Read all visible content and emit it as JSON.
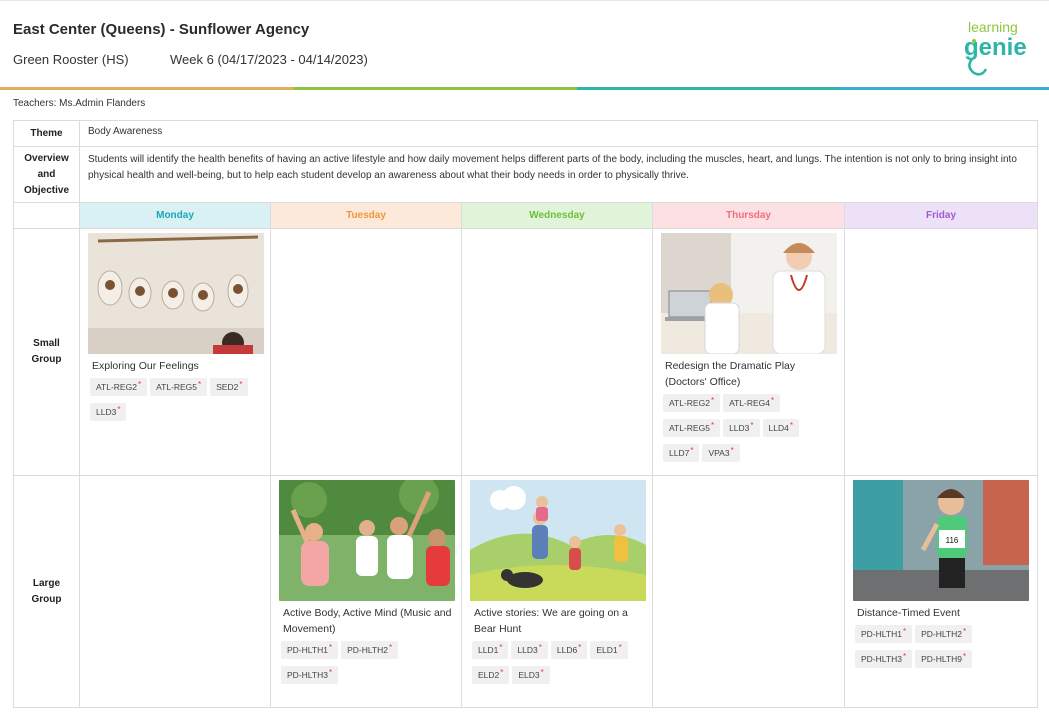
{
  "header": {
    "title": "East Center (Queens) - Sunflower Agency",
    "class_name": "Green Rooster (HS)",
    "week": "Week 6 (04/17/2023 - 04/14/2023)",
    "logo_line1": "learning",
    "logo_line2": "genie"
  },
  "teachers": "Teachers: Ms.Admin Flanders",
  "theme": {
    "label": "Theme",
    "value": "Body Awareness"
  },
  "overview": {
    "label_line1": "Overview",
    "label_line2": "and",
    "label_line3": "Objective",
    "value": "Students will identify the health benefits of having an active lifestyle and how daily movement helps different parts of the body, including the muscles, heart, and lungs. The intention is not only to bring insight into physical health and well-being, but to help each student develop an awareness about what their body needs in order to physically thrive."
  },
  "days": [
    {
      "label": "Monday",
      "bg": "#d9f1f4",
      "color": "#19a6b7"
    },
    {
      "label": "Tuesday",
      "bg": "#fde9d9",
      "color": "#f0963c"
    },
    {
      "label": "Wednesday",
      "bg": "#e1f3d8",
      "color": "#6cbf3c"
    },
    {
      "label": "Thursday",
      "bg": "#fde0e3",
      "color": "#ee6f7d"
    },
    {
      "label": "Friday",
      "bg": "#ece1f6",
      "color": "#a05ad2"
    }
  ],
  "small_group": {
    "label_line1": "Small",
    "label_line2": "Group",
    "monday": {
      "title": "Exploring Our Feelings",
      "tags": [
        "ATL-REG2",
        "ATL-REG5",
        "SED2",
        "LLD3"
      ]
    },
    "thursday": {
      "title": "Redesign the Dramatic Play (Doctors' Office)",
      "tags": [
        "ATL-REG2",
        "ATL-REG4",
        "ATL-REG5",
        "LLD3",
        "LLD4",
        "LLD7",
        "VPA3"
      ]
    }
  },
  "large_group": {
    "label_line1": "Large",
    "label_line2": "Group",
    "tuesday": {
      "title": "Active Body, Active Mind (Music and Movement)",
      "tags": [
        "PD-HLTH1",
        "PD-HLTH2",
        "PD-HLTH3"
      ]
    },
    "wednesday": {
      "title": "Active stories: We are going on a Bear Hunt",
      "tags": [
        "LLD1",
        "LLD3",
        "LLD6",
        "ELD1",
        "ELD2",
        "ELD3"
      ]
    },
    "friday": {
      "title": "Distance-Timed Event",
      "tags": [
        "PD-HLTH1",
        "PD-HLTH2",
        "PD-HLTH3",
        "PD-HLTH9"
      ],
      "bib_number": "116"
    }
  },
  "colors": {
    "star": "#e53935",
    "logo_green": "#8cc63f",
    "logo_teal": "#2cb5a8"
  }
}
